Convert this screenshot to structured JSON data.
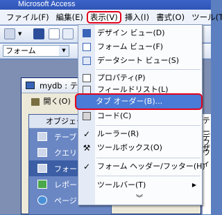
{
  "window_title": "Microsoft Access",
  "menubar": {
    "items": [
      "ファイル(F)",
      "編集(E)",
      "表示(V)",
      "挿入(I)",
      "書式(O)",
      "ツール(T)"
    ]
  },
  "toolbar": {
    "object_combo": "フォーム"
  },
  "db_window": {
    "title": "mydb : テ",
    "open_button": "開く(O)",
    "objects_header": "オブジェク",
    "objects": [
      "テーブ",
      "クエリ",
      "フォー",
      "レポー",
      "ページ"
    ]
  },
  "right_fragments": [
    "テーフ",
    "デザ",
    "ウィ"
  ],
  "view_menu": {
    "design_view": "デザイン ビュー(D)",
    "form_view": "フォーム ビュー(F)",
    "datasheet_view": "データシート ビュー(S)",
    "properties": "プロパティ(P)",
    "field_list": "フィールドリスト(L)",
    "tab_order": "タブ オーダー(B)...",
    "code": "コード(C)",
    "ruler": "ルーラー(R)",
    "toolbox": "ツールボックス(O)",
    "form_header_footer": "フォーム ヘッダー/フッター(H)",
    "toolbars": "ツールバー(T)"
  },
  "colors": {
    "highlight_border": "#e3001b",
    "highlight_fill": "#4a7bd6"
  }
}
